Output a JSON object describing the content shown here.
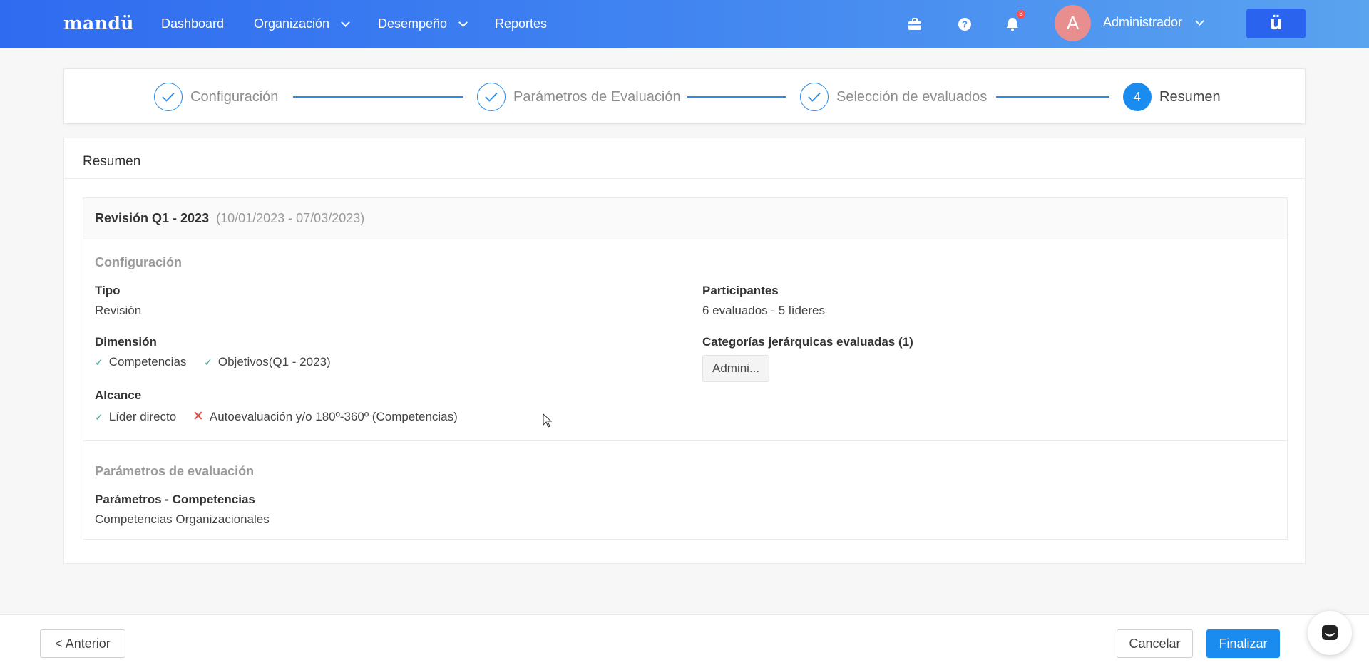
{
  "nav": {
    "logo": "mandü",
    "items": [
      {
        "label": "Dashboard"
      },
      {
        "label": "Organización"
      },
      {
        "label": "Desempeño"
      },
      {
        "label": "Reportes"
      }
    ],
    "notifications_count": "3",
    "user": {
      "initial": "A",
      "name": "Administrador"
    },
    "brand_button": "ü"
  },
  "stepper": {
    "steps": [
      {
        "label": "Configuración",
        "status": "done"
      },
      {
        "label": "Parámetros de Evaluación",
        "status": "done"
      },
      {
        "label": "Selección de evaluados",
        "status": "done"
      },
      {
        "label": "Resumen",
        "status": "active",
        "number": "4"
      }
    ]
  },
  "summary": {
    "title": "Resumen",
    "review_name": "Revisión Q1 - 2023",
    "review_dates": "(10/01/2023 - 07/03/2023)",
    "config_section": "Configuración",
    "tipo_label": "Tipo",
    "tipo_value": "Revisión",
    "dimension_label": "Dimensión",
    "dimension_items": [
      "Competencias",
      "Objetivos(Q1 - 2023)"
    ],
    "alcance_label": "Alcance",
    "alcance_included": "Líder directo",
    "alcance_excluded": "Autoevaluación y/o 180º-360º (Competencias)",
    "participantes_label": "Participantes",
    "participantes_value": "6 evaluados - 5 líderes",
    "categorias_label": "Categorías jerárquicas evaluadas (1)",
    "categorias_tag": "Admini...",
    "params_section": "Parámetros de evaluación",
    "params_label": "Parámetros - Competencias",
    "params_value": "Competencias Organizacionales"
  },
  "footer": {
    "prev": "< Anterior",
    "cancel": "Cancelar",
    "finish": "Finalizar"
  },
  "colors": {
    "nav_start": "#2f6bf0",
    "nav_end": "#5aa3ef",
    "primary": "#1a8cf0",
    "check": "#47a89a",
    "cross": "#e0453b"
  }
}
